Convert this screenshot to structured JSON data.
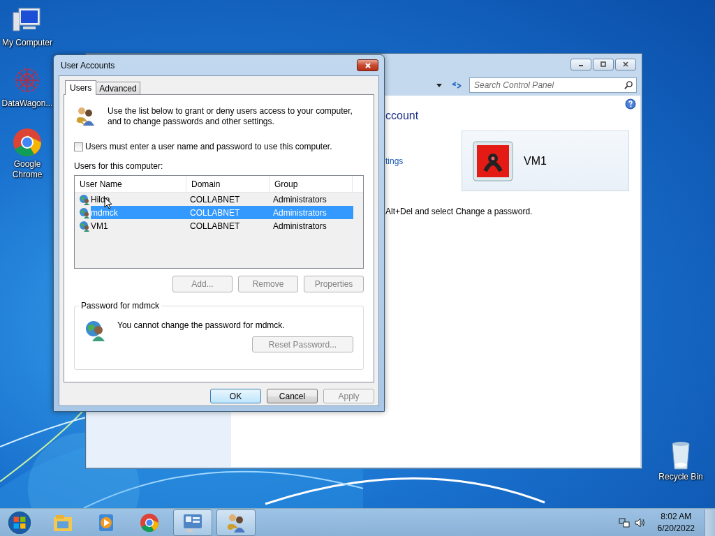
{
  "desktop_icons": [
    {
      "label": "My Computer",
      "kind": "computer"
    },
    {
      "label": "DataWagon...",
      "kind": "web"
    },
    {
      "label": "Google\nChrome",
      "kind": "chrome"
    },
    {
      "label": "Recycle Bin",
      "kind": "bin"
    }
  ],
  "control_panel": {
    "search": {
      "placeholder": "Search Control Panel"
    },
    "heading": "ccount",
    "link": "tings",
    "account": {
      "name": "VM1"
    },
    "note": "Alt+Del and select Change a password."
  },
  "dialog": {
    "title": "User Accounts",
    "tabs": [
      {
        "label": "Users",
        "selected": true
      },
      {
        "label": "Advanced",
        "selected": false
      }
    ],
    "intro": "Use the list below to grant or deny users access to your computer,\nand to change passwords and other settings.",
    "require_login": {
      "label": "Users must enter a user name and password to use this computer.",
      "checked": false
    },
    "list_label": "Users for this computer:",
    "columns": [
      "User Name",
      "Domain",
      "Group"
    ],
    "rows": [
      {
        "user_name": "Hilda",
        "domain": "COLLABNET",
        "group": "Administrators",
        "selected": false
      },
      {
        "user_name": "mdmck",
        "domain": "COLLABNET",
        "group": "Administrators",
        "selected": true
      },
      {
        "user_name": "VM1",
        "domain": "COLLABNET",
        "group": "Administrators",
        "selected": false
      }
    ],
    "list_buttons": [
      {
        "label": "Add...",
        "disabled": true
      },
      {
        "label": "Remove",
        "disabled": true
      },
      {
        "label": "Properties",
        "disabled": true
      }
    ],
    "password_group": {
      "title": "Password for mdmck",
      "message": "You cannot change the password for mdmck.",
      "button": {
        "label": "Reset Password...",
        "disabled": true
      }
    },
    "footer_buttons": [
      {
        "label": "OK",
        "disabled": false,
        "default": true
      },
      {
        "label": "Cancel",
        "disabled": false,
        "default": false
      },
      {
        "label": "Apply",
        "disabled": true,
        "default": false
      }
    ]
  },
  "taskbar": {
    "items": [
      {
        "kind": "explorer",
        "selected": false
      },
      {
        "kind": "media",
        "selected": false
      },
      {
        "kind": "chrome",
        "selected": false
      },
      {
        "kind": "control",
        "selected": true
      },
      {
        "kind": "users",
        "selected": true
      }
    ],
    "time": "8:02 AM",
    "date": "6/20/2022"
  }
}
